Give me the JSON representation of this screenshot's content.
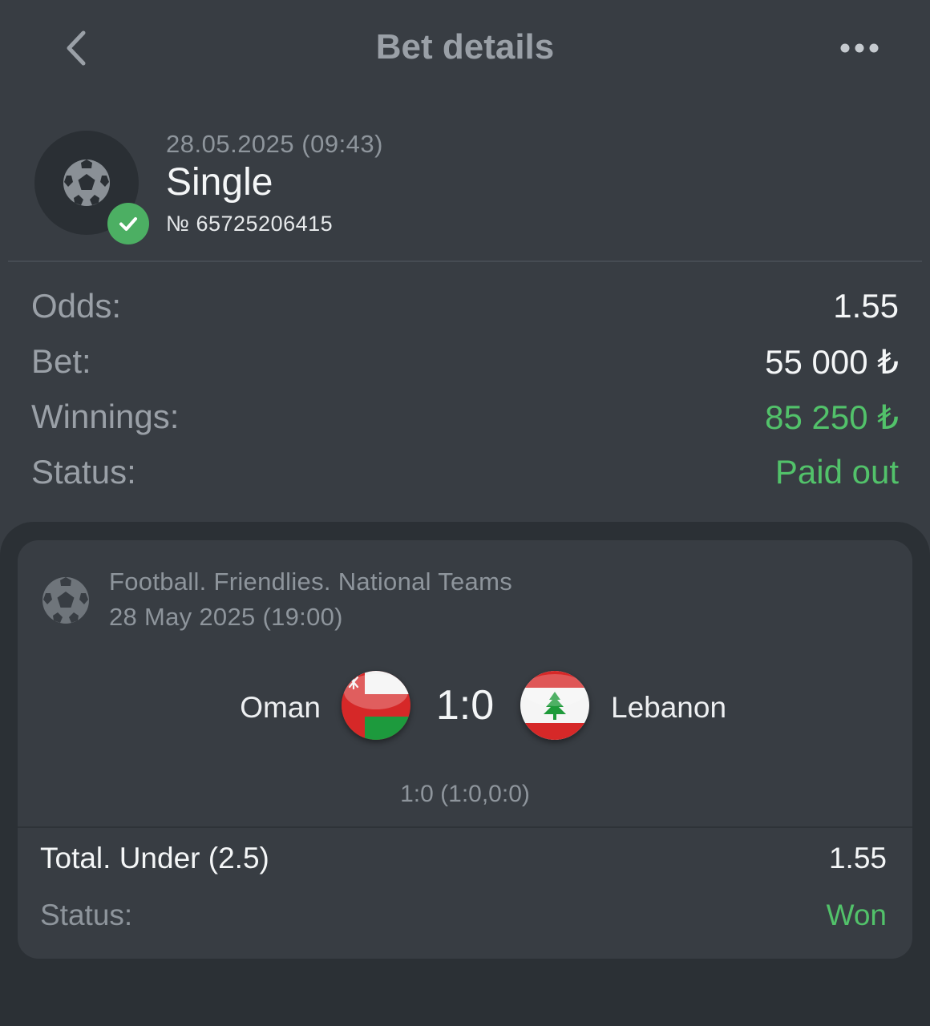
{
  "header": {
    "title": "Bet details",
    "back_icon": "chevron-left-icon",
    "more_icon": "more-horizontal-icon"
  },
  "bet": {
    "date": "28.05.2025 (09:43)",
    "type": "Single",
    "number": "№ 65725206415",
    "sport_icon": "football-icon",
    "status_badge_icon": "check-icon"
  },
  "summary": {
    "odds_label": "Odds:",
    "odds_value": "1.55",
    "bet_label": "Bet:",
    "bet_value": "55 000 ₺",
    "winnings_label": "Winnings:",
    "winnings_value": "85 250 ₺",
    "status_label": "Status:",
    "status_value": "Paid out"
  },
  "event": {
    "league": "Football. Friendlies. National Teams",
    "date": "28 May 2025 (19:00)",
    "home_team": "Oman",
    "away_team": "Lebanon",
    "home_flag": "oman-flag-icon",
    "away_flag": "lebanon-flag-icon",
    "score": "1:0",
    "period_score": "1:0 (1:0,0:0)"
  },
  "selection": {
    "market": "Total. Under (2.5)",
    "odds": "1.55",
    "status_label": "Status:",
    "status_value": "Won"
  },
  "colors": {
    "background": "#383d43",
    "bottom_sheet": "#2b3035",
    "success": "#52c26a",
    "muted_text": "#8e959c"
  }
}
